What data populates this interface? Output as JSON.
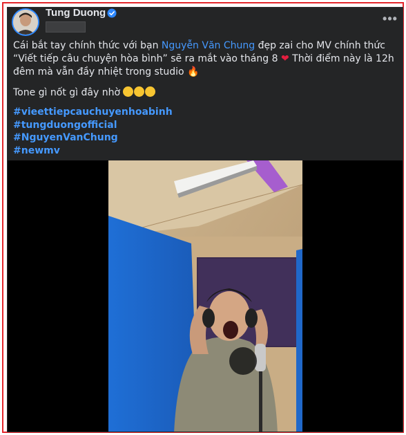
{
  "post": {
    "author": "Tung Duong",
    "verified": true,
    "more_options_label": "•••",
    "text_before_mention": "Cái bắt tay chính thức với bạn ",
    "mention": "Nguyễn Văn Chung",
    "text_after_mention": " đẹp zai cho MV chính thức “Viết tiếp câu chuyện hòa bình” sẽ ra mắt vào tháng 8 ",
    "text_after_heart": " Thời điểm này là 12h đêm mà vẫn đầy nhiệt trong studio ",
    "line2_text": "Tone gì nốt gì đây nhờ ",
    "hashtags": [
      "#vieettiepcauchuyenhoabinh",
      "#tungduongofficial",
      "#NguyenVanChung",
      "#newmv"
    ]
  },
  "icons": {
    "verified": "verified-badge-icon",
    "heart": "red-heart-icon",
    "fire": "fire-icon",
    "laugh": "rolling-laughing-emoji",
    "wink": "winking-tongue-emoji",
    "grin": "grinning-emoji"
  },
  "colors": {
    "card_bg": "#242526",
    "text": "#e4e6eb",
    "link": "#4599ff",
    "frame": "#e3262b"
  }
}
